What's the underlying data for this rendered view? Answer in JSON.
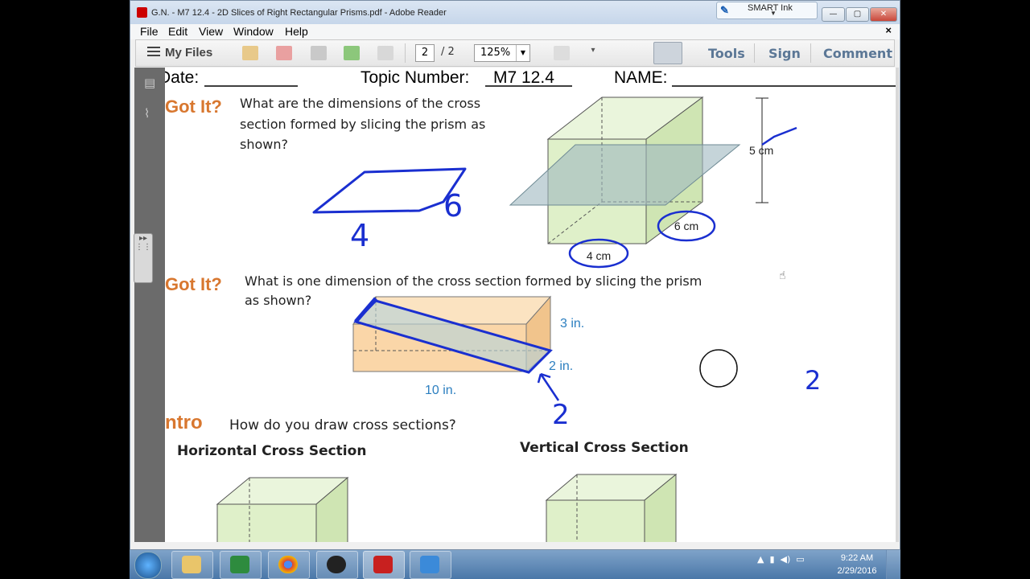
{
  "window": {
    "title": "G.N. - M7 12.4 - 2D Slices of Right Rectangular Prisms.pdf - Adobe Reader",
    "smart_ink_label": "SMART Ink",
    "min": "—",
    "max": "▢",
    "close": "✕"
  },
  "menu": {
    "items": [
      "File",
      "Edit",
      "View",
      "Window",
      "Help"
    ],
    "close": "×"
  },
  "toolbar": {
    "my_files": "My Files",
    "page_current": "2",
    "page_total": "/ 2",
    "zoom": "125%",
    "tools": "Tools",
    "sign": "Sign",
    "comment": "Comment"
  },
  "document": {
    "header_date": "Date:",
    "header_topic": "Topic Number:",
    "topic_value": "M7 12.4",
    "header_name": "NAME:",
    "got_it_1": "Got It?",
    "q1_lines": [
      "What are the dimensions of the cross",
      "section formed by slicing the prism as",
      "shown?"
    ],
    "prism1_height": "5 cm",
    "prism1_depth": "6 cm",
    "prism1_width": "4 cm",
    "hand_4": "4",
    "hand_6": "6",
    "got_it_2": "Got It?",
    "q2_lines": [
      "What is one dimension of the cross section formed by slicing the prism",
      "as shown?"
    ],
    "prism2_height": "3 in.",
    "prism2_depth": "2 in.",
    "prism2_length": "10 in.",
    "hand_2a": "2",
    "hand_2b": "2",
    "intro": "ntro",
    "intro_q": "How do you draw cross sections?",
    "horizontal_title": "Horizontal Cross Section",
    "vertical_title": "Vertical Cross Section"
  },
  "tray": {
    "time": "9:22 AM",
    "date": "2/29/2016"
  },
  "colors": {
    "accent_orange": "#d8772f",
    "ink_blue": "#1a2fd0",
    "label_blue": "#2c7fc0",
    "prism_green": "#dff0c9"
  }
}
